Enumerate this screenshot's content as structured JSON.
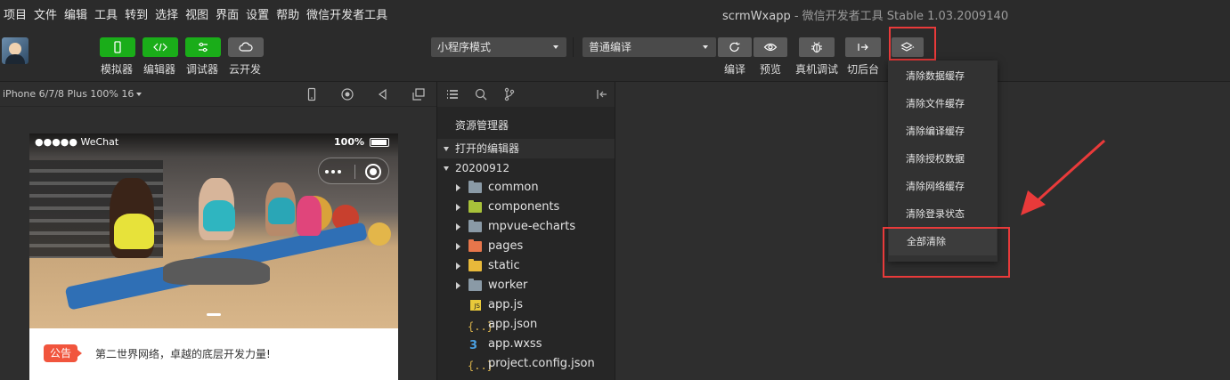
{
  "menubar": {
    "items": [
      "项目",
      "文件",
      "编辑",
      "工具",
      "转到",
      "选择",
      "视图",
      "界面",
      "设置",
      "帮助",
      "微信开发者工具"
    ],
    "title_app": "scrmWxapp",
    "title_rest": " - 微信开发者工具 Stable 1.03.2009140"
  },
  "toolbar": {
    "left_buttons": [
      {
        "label": "模拟器",
        "icon": "phone-icon"
      },
      {
        "label": "编辑器",
        "icon": "code-icon"
      },
      {
        "label": "调试器",
        "icon": "sliders-icon"
      },
      {
        "label": "云开发",
        "icon": "cloud-icon"
      }
    ],
    "mode_select": "小程序模式",
    "compile_select": "普通编译",
    "right_labels": [
      "编译",
      "预览",
      "真机调试",
      "切后台"
    ]
  },
  "dropdown": {
    "items": [
      "清除数据缓存",
      "清除文件缓存",
      "清除编译缓存",
      "清除授权数据",
      "清除网络缓存",
      "清除登录状态",
      "全部清除"
    ]
  },
  "simulator": {
    "device": "iPhone 6/7/8 Plus 100% 16",
    "carrier": "●●●●● WeChat",
    "battery": "100%",
    "notice_badge": "公告",
    "notice_text": "第二世界网络，卓越的底层开发力量!"
  },
  "explorer": {
    "title": "资源管理器",
    "open_editors": "打开的编辑器",
    "project": "20200912",
    "tree": [
      {
        "name": "common",
        "type": "folder"
      },
      {
        "name": "components",
        "type": "folder"
      },
      {
        "name": "mpvue-echarts",
        "type": "folder"
      },
      {
        "name": "pages",
        "type": "folder"
      },
      {
        "name": "static",
        "type": "folder"
      },
      {
        "name": "worker",
        "type": "folder"
      },
      {
        "name": "app.js",
        "type": "js"
      },
      {
        "name": "app.json",
        "type": "json"
      },
      {
        "name": "app.wxss",
        "type": "wxss"
      },
      {
        "name": "project.config.json",
        "type": "json"
      }
    ]
  },
  "colors": {
    "accent_green": "#1aad19",
    "highlight_red": "#e93a3a",
    "notice_red": "#f1553d"
  }
}
